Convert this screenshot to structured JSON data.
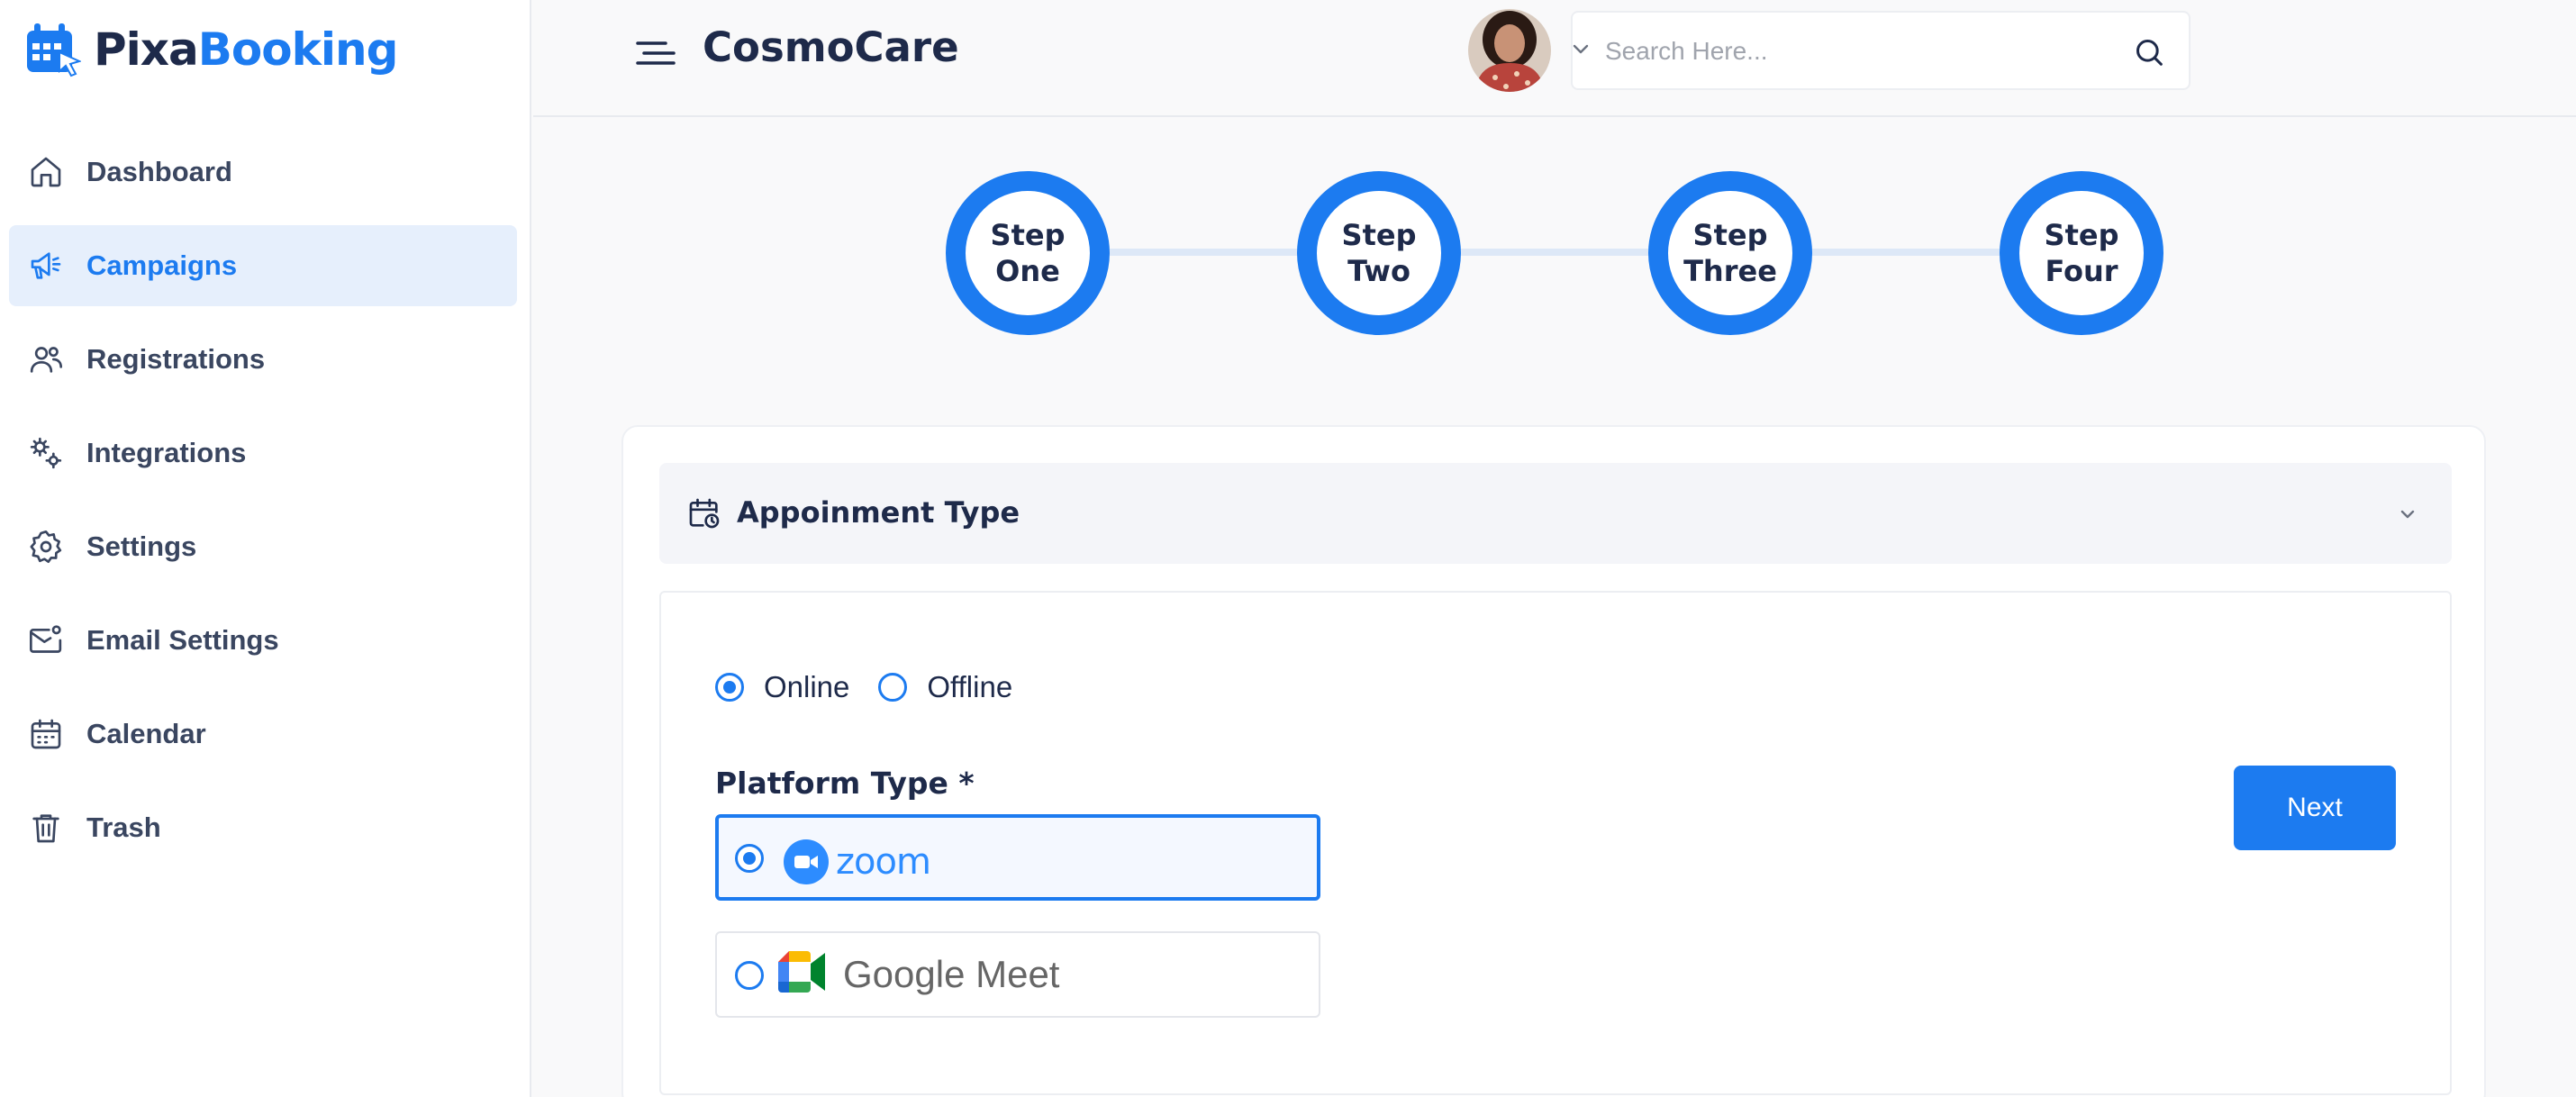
{
  "brand": {
    "name_part1": "Pixa",
    "name_part2": "Booking",
    "accent": "#1c7bf0",
    "dark": "#1e2a4a"
  },
  "sidebar": {
    "items": [
      {
        "label": "Dashboard",
        "icon": "home-icon",
        "active": false
      },
      {
        "label": "Campaigns",
        "icon": "megaphone-icon",
        "active": true
      },
      {
        "label": "Registrations",
        "icon": "users-icon",
        "active": false
      },
      {
        "label": "Integrations",
        "icon": "integrations-icon",
        "active": false
      },
      {
        "label": "Settings",
        "icon": "gear-icon",
        "active": false
      },
      {
        "label": "Email Settings",
        "icon": "mail-settings-icon",
        "active": false
      },
      {
        "label": "Calendar",
        "icon": "calendar-icon",
        "active": false
      },
      {
        "label": "Trash",
        "icon": "trash-icon",
        "active": false
      }
    ]
  },
  "header": {
    "title": "CosmoCare",
    "search_placeholder": "Search Here...",
    "menu_icon": "menu-icon",
    "search_icon": "search-icon"
  },
  "stepper": {
    "steps": [
      {
        "line1": "Step",
        "line2": "One"
      },
      {
        "line1": "Step",
        "line2": "Two"
      },
      {
        "line1": "Step",
        "line2": "Three"
      },
      {
        "line1": "Step",
        "line2": "Four"
      }
    ]
  },
  "form": {
    "section_title": "Appoinment Type",
    "mode_options": [
      {
        "label": "Online",
        "checked": true
      },
      {
        "label": "Offline",
        "checked": false
      }
    ],
    "platform_label": "Platform Type *",
    "platforms": [
      {
        "name": "zoom",
        "selected": true
      },
      {
        "name": "Google Meet",
        "selected": false
      }
    ],
    "next_label": "Next"
  }
}
